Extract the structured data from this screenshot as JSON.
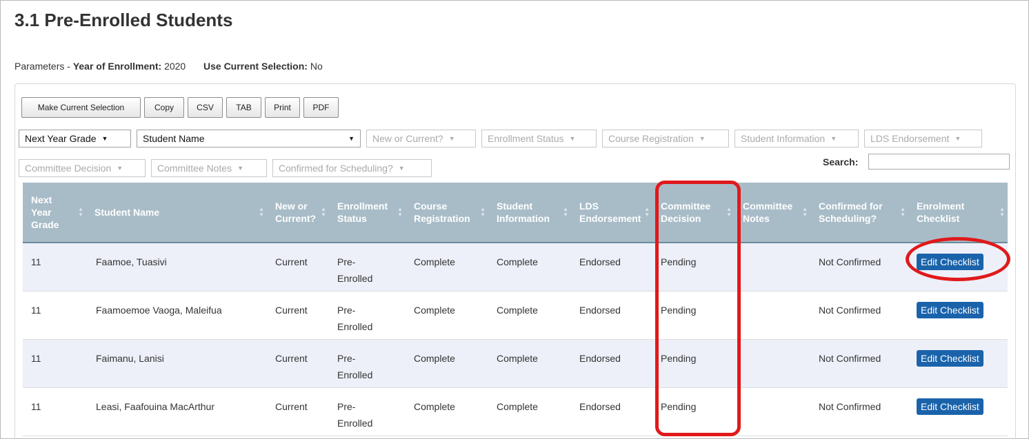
{
  "page": {
    "title": "3.1 Pre-Enrolled Students",
    "params_prefix": "Parameters - ",
    "year_label": "Year of Enrollment:",
    "year_value": "2020",
    "selection_label": "Use Current Selection:",
    "selection_value": "No"
  },
  "toolbar": {
    "make_selection": "Make Current Selection",
    "copy": "Copy",
    "csv": "CSV",
    "tab": "TAB",
    "print": "Print",
    "pdf": "PDF"
  },
  "filters": {
    "next_year_grade": "Next Year Grade",
    "student_name": "Student Name",
    "new_or_current": "New or Current?",
    "enrollment_status": "Enrollment Status",
    "course_registration": "Course Registration",
    "student_information": "Student Information",
    "lds_endorsement": "LDS Endorsement",
    "committee_decision": "Committee Decision",
    "committee_notes": "Committee Notes",
    "confirmed_scheduling": "Confirmed for Scheduling?",
    "arrow": "▼"
  },
  "search": {
    "label": "Search:",
    "value": ""
  },
  "table": {
    "headers": {
      "grade_1": "Next",
      "grade_2": "Year",
      "grade_3": "Grade",
      "name": "Student Name",
      "new_1": "New or",
      "new_2": "Current?",
      "status_1": "Enrollment",
      "status_2": "Status",
      "course_1": "Course",
      "course_2": "Registration",
      "info_1": "Student",
      "info_2": "Information",
      "lds_1": "LDS",
      "lds_2": "Endorsement",
      "decision_1": "Committee",
      "decision_2": "Decision",
      "notes_1": "Committee",
      "notes_2": "Notes",
      "confirmed_1": "Confirmed for",
      "confirmed_2": "Scheduling?",
      "checklist_1": "Enrolment",
      "checklist_2": "Checklist"
    },
    "rows": [
      {
        "grade": "11",
        "name": "Faamoe, Tuasivi",
        "new": "Current",
        "status_1": "Pre-",
        "status_2": "Enrolled",
        "course": "Complete",
        "info": "Complete",
        "lds": "Endorsed",
        "decision": "Pending",
        "notes": "",
        "confirmed": "Not Confirmed",
        "action": "Edit Checklist"
      },
      {
        "grade": "11",
        "name": "Faamoemoe Vaoga, Maleifua",
        "new": "Current",
        "status_1": "Pre-",
        "status_2": "Enrolled",
        "course": "Complete",
        "info": "Complete",
        "lds": "Endorsed",
        "decision": "Pending",
        "notes": "",
        "confirmed": "Not Confirmed",
        "action": "Edit Checklist"
      },
      {
        "grade": "11",
        "name": "Faimanu, Lanisi",
        "new": "Current",
        "status_1": "Pre-",
        "status_2": "Enrolled",
        "course": "Complete",
        "info": "Complete",
        "lds": "Endorsed",
        "decision": "Pending",
        "notes": "",
        "confirmed": "Not Confirmed",
        "action": "Edit Checklist"
      },
      {
        "grade": "11",
        "name": "Leasi, Faafouina MacArthur",
        "new": "Current",
        "status_1": "Pre-",
        "status_2": "Enrolled",
        "course": "Complete",
        "info": "Complete",
        "lds": "Endorsed",
        "decision": "Pending",
        "notes": "",
        "confirmed": "Not Confirmed",
        "action": "Edit Checklist"
      }
    ]
  },
  "colors": {
    "header_bg": "#a8bcc8",
    "odd_row_bg": "#edf0f8",
    "button_blue": "#1a63ab",
    "highlight_red": "#e0191b"
  },
  "icons": {
    "sort": "sort-arrows-icon",
    "dropdown": "dropdown-arrow-icon"
  }
}
